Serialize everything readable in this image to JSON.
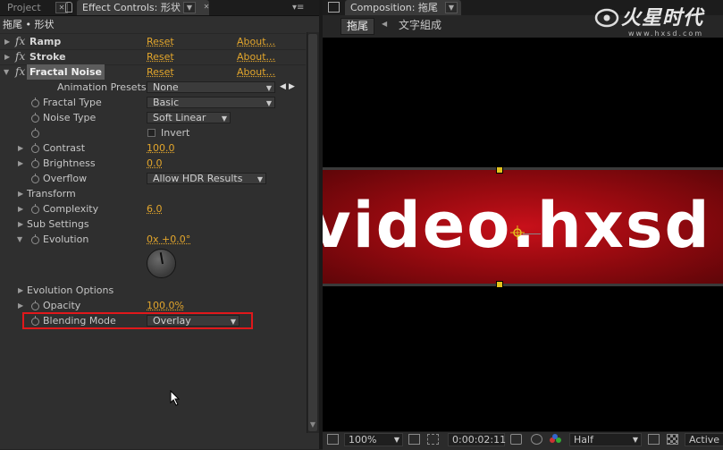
{
  "left_panel": {
    "tabs": {
      "project": "Project",
      "effect_controls": "Effect Controls: 形状"
    },
    "subtitle": "拖尾 • 形状",
    "effects": [
      {
        "name": "Ramp",
        "reset": "Reset",
        "about": "About..."
      },
      {
        "name": "Stroke",
        "reset": "Reset",
        "about": "About..."
      },
      {
        "name": "Fractal Noise",
        "reset": "Reset",
        "about": "About..."
      }
    ],
    "properties": {
      "animation_presets_label": "Animation Presets:",
      "animation_presets_value": "None",
      "fractal_type_label": "Fractal Type",
      "fractal_type_value": "Basic",
      "noise_type_label": "Noise Type",
      "noise_type_value": "Soft Linear",
      "invert_label": "Invert",
      "contrast_label": "Contrast",
      "contrast_value": "100.0",
      "brightness_label": "Brightness",
      "brightness_value": "0.0",
      "overflow_label": "Overflow",
      "overflow_value": "Allow HDR Results",
      "transform_label": "Transform",
      "complexity_label": "Complexity",
      "complexity_value": "6.0",
      "sub_settings_label": "Sub Settings",
      "evolution_label": "Evolution",
      "evolution_value": "0x +0.0°",
      "evolution_options_label": "Evolution Options",
      "opacity_label": "Opacity",
      "opacity_value": "100.0%",
      "blending_mode_label": "Blending Mode",
      "blending_mode_value": "Overlay"
    }
  },
  "comp_panel": {
    "tab": "Composition: 拖尾",
    "breadcrumbs": [
      "拖尾",
      "文字組成"
    ],
    "logo_text": "火星时代",
    "logo_url": "www.hxsd.com",
    "canvas_text": "video.hxsd",
    "status": {
      "zoom": "100%",
      "timecode": "0:00:02:11",
      "resolution": "Half",
      "camera": "Active"
    }
  },
  "colors": {
    "link": "#e3a62c",
    "highlight": "#e0181b",
    "banner": "#c8101a"
  }
}
